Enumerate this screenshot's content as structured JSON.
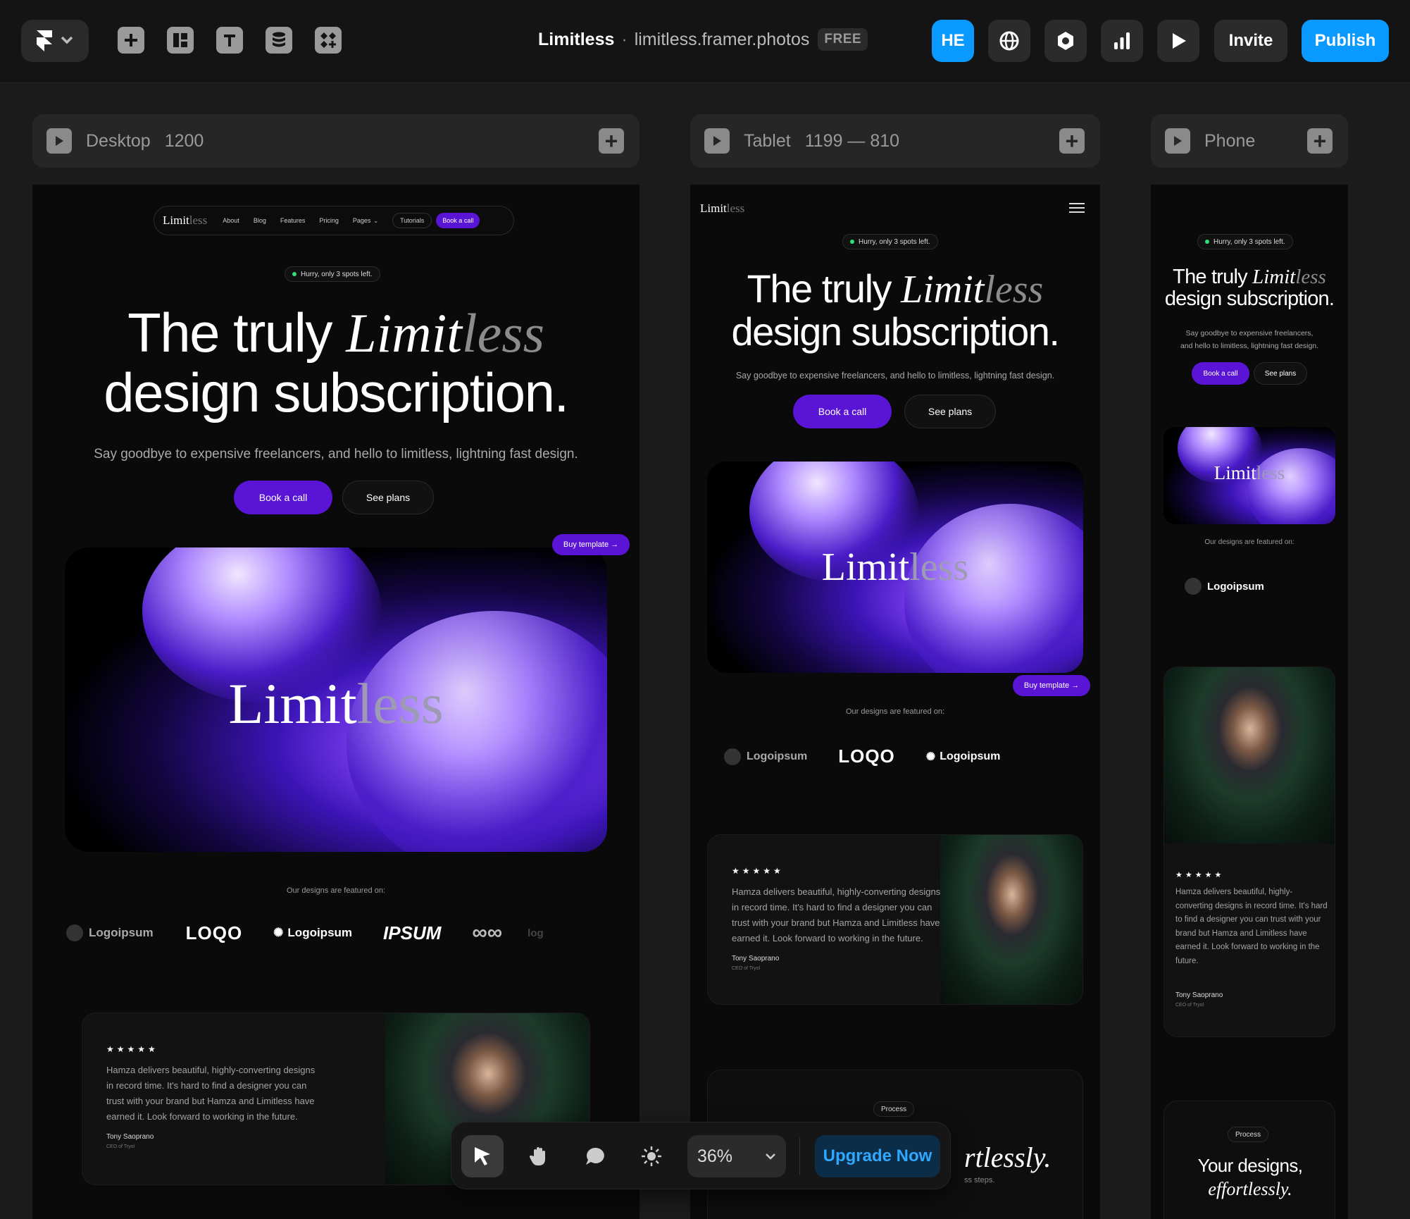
{
  "topbar": {
    "project_name": "Limitless",
    "separator": "·",
    "domain": "limitless.framer.photos",
    "plan_badge": "FREE",
    "user_initials": "HE",
    "invite_label": "Invite",
    "publish_label": "Publish",
    "tools": [
      "insert-icon",
      "layout-icon",
      "text-icon",
      "cms-icon",
      "components-icon"
    ],
    "icons": [
      "globe-icon",
      "settings-icon",
      "analytics-icon",
      "play-icon"
    ],
    "accent": "#0a99ff"
  },
  "frames": {
    "desktop": {
      "label": "Desktop",
      "size": "1200"
    },
    "tablet": {
      "label": "Tablet",
      "size": "1199 — 810"
    },
    "phone": {
      "label": "Phone"
    }
  },
  "site": {
    "brand_a": "Limit",
    "brand_b": "less",
    "nav": [
      "About",
      "Blog",
      "Features",
      "Pricing",
      "Pages",
      "Tutorials"
    ],
    "nav_cta": "Book a call",
    "badge": "Hurry, only 3 spots left.",
    "headline_a": "The truly",
    "headline_serif_a": "Limit",
    "headline_serif_b": "less",
    "headline_b": "design subscription.",
    "subhead": "Say goodbye to expensive freelancers, and hello to limitless, lightning fast design.",
    "subhead_phone_1": "Say goodbye to expensive freelancers,",
    "subhead_phone_2": "and hello to limitless, lightning fast design.",
    "cta_primary": "Book a call",
    "cta_secondary": "See plans",
    "buy_template": "Buy template",
    "featured_on": "Our designs are featured on:",
    "logos": [
      "Logoipsum",
      "LOQO",
      "Logoipsum",
      "IPSUM"
    ],
    "stars": "★★★★★",
    "testimonial_1": "Hamza delivers beautiful, highly-converting designs",
    "testimonial_2": "in record time. It's hard to find a designer you can",
    "testimonial_3": "trust with your brand but Hamza and Limitless have",
    "testimonial_4": "earned it. Look forward to working in the future.",
    "testimonial_full": "Hamza delivers beautiful, highly-converting designs in record time. It's hard to find a designer you can trust with your brand but Hamza and Limitless have earned it. Look forward to working in the future.",
    "author": "Tony Saoprano",
    "author_role": "CEO of Tryol",
    "process_badge": "Process",
    "process_title_a": "Your designs,",
    "process_title_b": "effortlessly.",
    "process_tablet_partial": "rtlessly.",
    "process_sub_partial": "ss steps.",
    "cut_logo": "log",
    "brand_color": "#5a14d6"
  },
  "toolbar": {
    "zoom": "36%",
    "upgrade_label": "Upgrade Now",
    "tools": [
      "cursor-icon",
      "hand-icon",
      "comment-icon",
      "theme-icon"
    ]
  }
}
